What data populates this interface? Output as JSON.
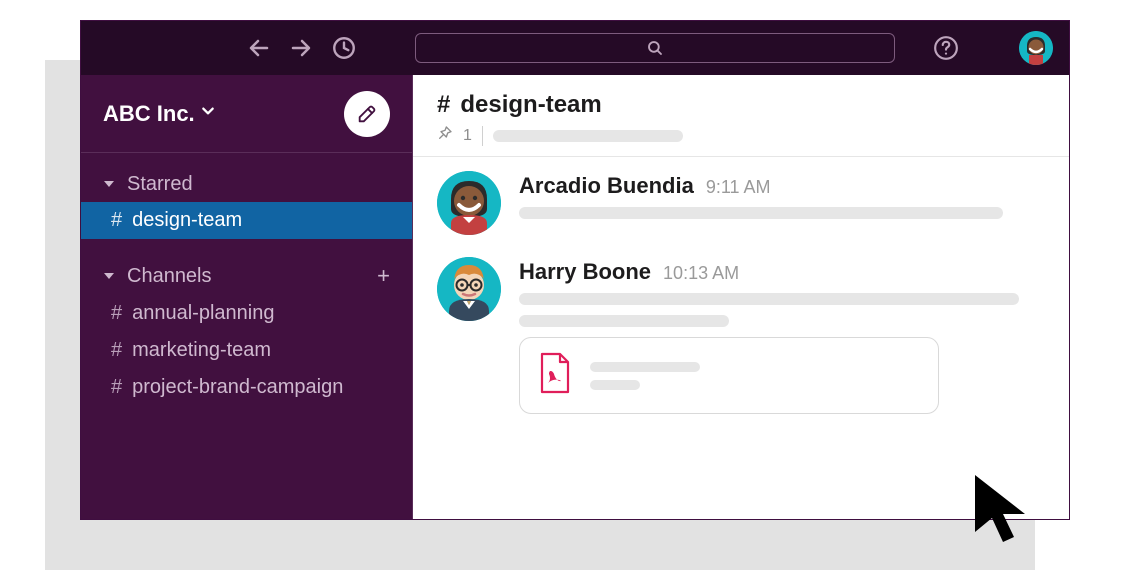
{
  "workspace": {
    "name": "ABC Inc."
  },
  "sidebar": {
    "starred": {
      "label": "Starred",
      "items": [
        {
          "name": "design-team",
          "active": true
        }
      ]
    },
    "channels": {
      "label": "Channels",
      "items": [
        {
          "name": "annual-planning"
        },
        {
          "name": "marketing-team"
        },
        {
          "name": "project-brand-campaign"
        }
      ]
    }
  },
  "channel": {
    "name": "design-team",
    "pinned_count": "1"
  },
  "messages": [
    {
      "author": "Arcadio Buendia",
      "time": "9:11 AM"
    },
    {
      "author": "Harry Boone",
      "time": "10:13 AM",
      "attachment": {
        "type": "pdf"
      }
    }
  ],
  "icons": {
    "hash": "#",
    "plus": "+"
  }
}
